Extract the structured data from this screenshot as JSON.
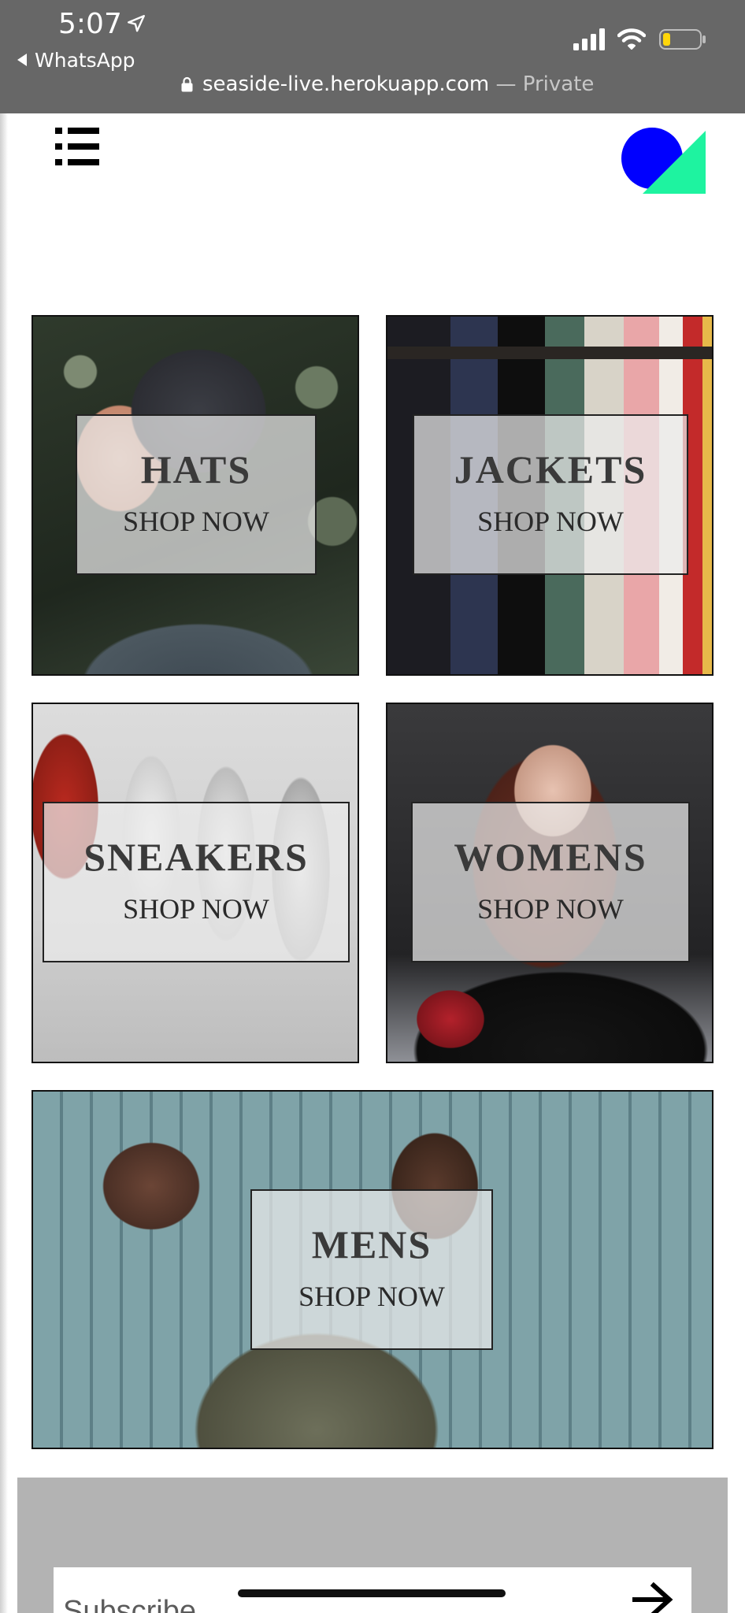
{
  "status_bar": {
    "time": "5:07",
    "back_app": "WhatsApp",
    "icons": [
      "location-arrow-icon",
      "signal-icon",
      "wifi-icon",
      "battery-icon"
    ]
  },
  "address_bar": {
    "url": "seaside-live.herokuapp.com",
    "separator": " — ",
    "mode": "Private"
  },
  "header": {
    "menu_icon": "hamburger-menu-icon",
    "logo": "brand-logo"
  },
  "categories": [
    {
      "title": "HATS",
      "cta": "SHOP NOW"
    },
    {
      "title": "JACKETS",
      "cta": "SHOP NOW"
    },
    {
      "title": "SNEAKERS",
      "cta": "SHOP NOW"
    },
    {
      "title": "WOMENS",
      "cta": "SHOP NOW"
    },
    {
      "title": "MENS",
      "cta": "SHOP NOW"
    }
  ],
  "footer": {
    "subscribe_placeholder": "Subscribe",
    "submit_icon": "arrow-right-icon"
  },
  "colors": {
    "status_bar_bg": "#676767",
    "logo_blue": "#0000ff",
    "logo_green": "#1ef3a0",
    "footer_bg": "#b3b3b3",
    "battery_fill": "#ffd60a"
  }
}
